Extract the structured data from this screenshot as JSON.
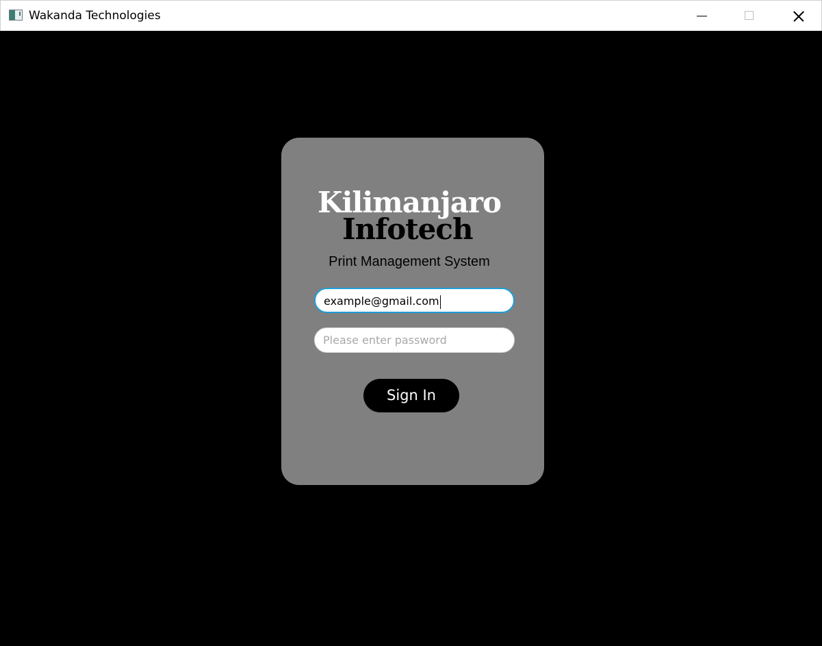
{
  "window": {
    "title": "Wakanda Technologies",
    "icon": "app-window-icon",
    "controls": [
      "minimize",
      "maximize",
      "close"
    ]
  },
  "login": {
    "brand_line1": "Kilimanjaro",
    "brand_line2": "Infotech",
    "subtitle": "Print Management System",
    "email_value": "example@gmail.com",
    "password_placeholder": "Please enter password",
    "sign_in_label": "Sign In"
  },
  "colors": {
    "background": "#000000",
    "card": "#808080",
    "focus_border": "#1b9fd9",
    "button": "#000000",
    "button_text": "#ffffff"
  }
}
